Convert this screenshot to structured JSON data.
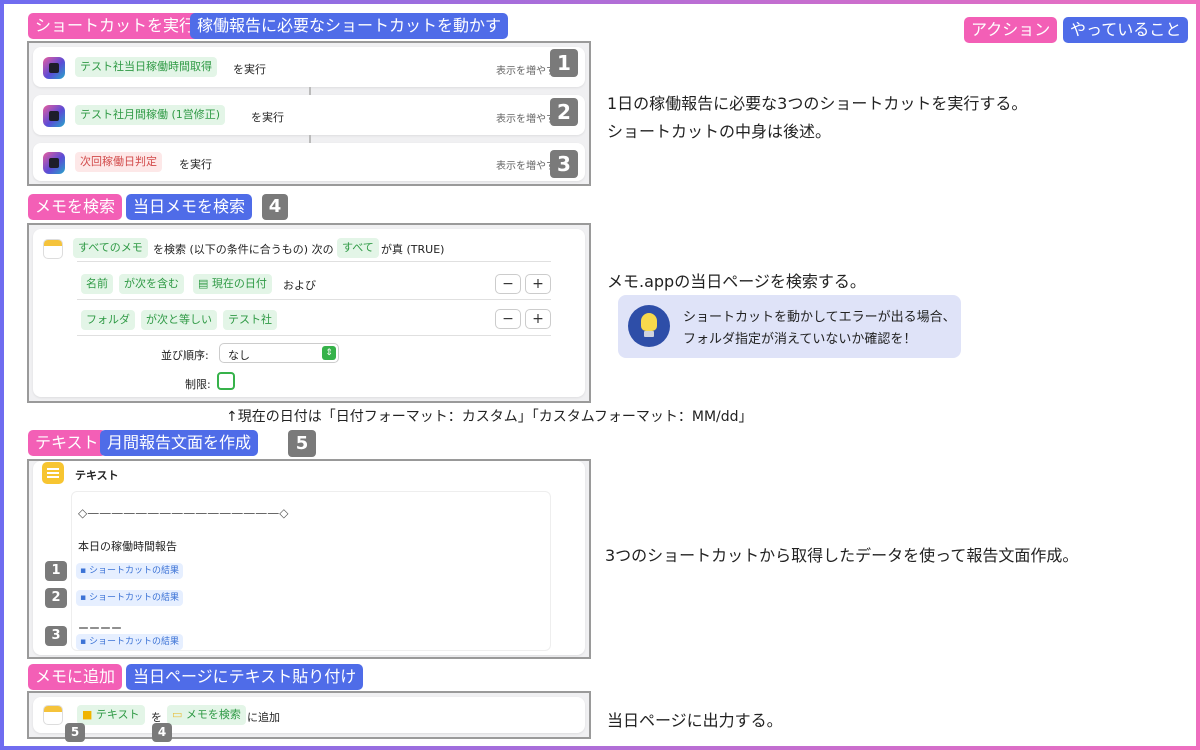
{
  "legend": {
    "action": "アクション",
    "doing": "やっていること"
  },
  "s1": {
    "tag": "ショートカットを実行",
    "title": "稼働報告に必要なショートカットを動かす",
    "rows": [
      {
        "chip": "テスト社当日稼働時間取得",
        "suffix": "を実行",
        "more": "表示を増やす",
        "num": "1"
      },
      {
        "chip": "テスト社月間稼働 (1営修正)",
        "suffix": "を実行",
        "more": "表示を増やす",
        "num": "2"
      },
      {
        "chip": "次回稼働日判定",
        "suffix": "を実行",
        "more": "表示を増やす",
        "num": "3"
      }
    ],
    "desc1": "1日の稼働報告に必要な3つのショートカットを実行する。",
    "desc2": "ショートカットの中身は後述。"
  },
  "s2": {
    "tag": "メモを検索",
    "title": "当日メモを検索",
    "num": "4",
    "all_notes": "すべてのメモ",
    "search_text": "を検索 (以下の条件に合うもの) 次の",
    "all": "すべて",
    "true_text": "が真 (TRUE)",
    "c1": {
      "name": "名前",
      "op": "が次を含む",
      "val": "現在の日付",
      "and": "および"
    },
    "c2": {
      "name": "フォルダ",
      "op": "が次と等しい",
      "val": "テスト社"
    },
    "sort_label": "並び順序:",
    "sort_value": "なし",
    "limit_label": "制限:",
    "minus": "−",
    "plus": "+",
    "desc": "メモ.appの当日ページを検索する。",
    "tip1": "ショートカットを動かしてエラーが出る場合、",
    "tip2": "フォルダ指定が消えていないか確認を！",
    "note": "↑現在の日付は「日付フォーマット：カスタム」「カスタムフォーマット：MM/dd」"
  },
  "s3": {
    "tag": "テキスト",
    "title": "月間報告文面を作成",
    "num": "5",
    "header": "テキスト",
    "line": "◇————————————————◇",
    "report": "本日の稼働時間報告",
    "result": "ショートカットの結果",
    "dashes": "ーーーー",
    "n1": "1",
    "n2": "2",
    "n3": "3",
    "desc": "3つのショートカットから取得したデータを使って報告文面作成。"
  },
  "s4": {
    "tag": "メモに追加",
    "title": "当日ページにテキスト貼り付け",
    "chip1": "テキスト",
    "wo": "を",
    "chip2": "メモを検索",
    "add": "に追加",
    "n5": "5",
    "n4": "4",
    "desc": "当日ページに出力する。"
  }
}
